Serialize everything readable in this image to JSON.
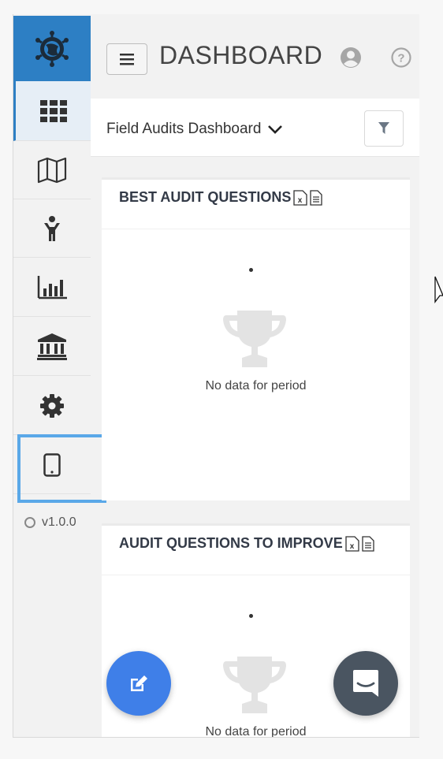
{
  "header": {
    "title": "DASHBOARD",
    "menu_icon": "hamburger-icon",
    "user_icon": "user-circle-icon",
    "help_icon": "help-circle-icon"
  },
  "sidebar": {
    "logo_icon": "globe-network-logo",
    "items": [
      {
        "icon": "grid-icon",
        "active": true
      },
      {
        "icon": "map-icon",
        "active": false
      },
      {
        "icon": "person-icon",
        "active": false
      },
      {
        "icon": "bar-chart-icon",
        "active": false
      },
      {
        "icon": "bank-icon",
        "active": false
      },
      {
        "icon": "gear-icon",
        "active": false
      },
      {
        "icon": "tablet-icon",
        "active": false
      }
    ],
    "version": "v1.0.0"
  },
  "dashboard_selector": {
    "label": "Field Audits Dashboard",
    "filter_icon": "filter-icon"
  },
  "cards": [
    {
      "title": "BEST AUDIT QUESTIONS",
      "empty_text": "No data for period"
    },
    {
      "title": "AUDIT QUESTIONS TO IMPROVE",
      "empty_text": "No data for period"
    }
  ],
  "colors": {
    "brand": "#2d7fc4",
    "fab": "#3f7fe8",
    "chat": "#4a5561",
    "focus": "#5aa8e8"
  }
}
